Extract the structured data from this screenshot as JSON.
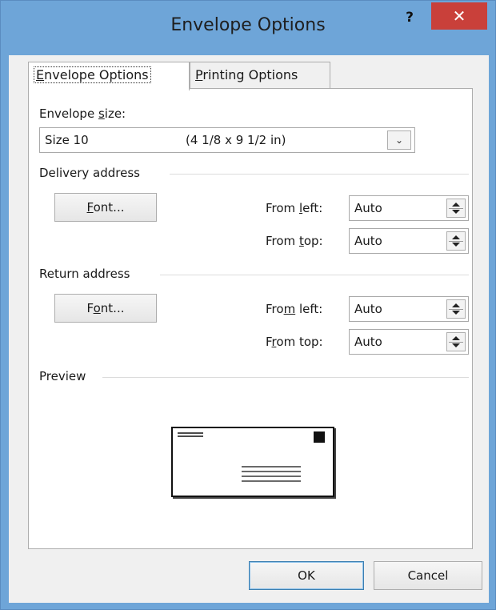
{
  "window": {
    "title": "Envelope Options",
    "help": "?",
    "close": "✕"
  },
  "tabs": [
    {
      "label": "Envelope Options",
      "mnemonic": "E",
      "rest": "nvelope Options"
    },
    {
      "label": "Printing Options",
      "mnemonic": "P",
      "rest": "rinting Options"
    }
  ],
  "envelope_size": {
    "label_pre": "Envelope ",
    "label_mn": "s",
    "label_post": "ize:",
    "value_name": "Size 10",
    "value_dims": "(4 1/8 x 9 1/2 in)"
  },
  "delivery": {
    "heading": "Delivery address",
    "font_button_mn": "F",
    "font_button_rest": "ont...",
    "from_left_pre": "From ",
    "from_left_mn": "l",
    "from_left_post": "eft:",
    "from_left_value": "Auto",
    "from_top_pre": "From ",
    "from_top_mn": "t",
    "from_top_post": "op:",
    "from_top_value": "Auto"
  },
  "return": {
    "heading": "Return address",
    "font_button_pre": "F",
    "font_button_mn": "o",
    "font_button_post": "nt...",
    "from_left_pre": "Fro",
    "from_left_mn": "m",
    "from_left_post": " left:",
    "from_left_value": "Auto",
    "from_top_pre": "F",
    "from_top_mn": "r",
    "from_top_post": "om top:",
    "from_top_value": "Auto"
  },
  "preview": {
    "heading": "Preview"
  },
  "buttons": {
    "ok": "OK",
    "cancel": "Cancel"
  }
}
